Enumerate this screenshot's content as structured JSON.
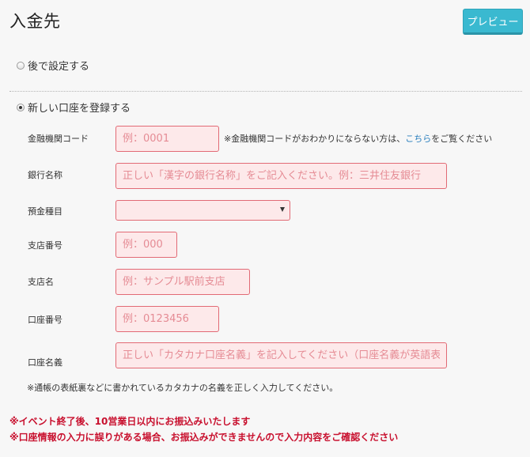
{
  "header": {
    "title": "入金先",
    "preview_label": "プレビュー"
  },
  "options": {
    "later": {
      "label": "後で設定する",
      "selected": false
    },
    "new_account": {
      "label": "新しい口座を登録する",
      "selected": true
    }
  },
  "form": {
    "bank_code": {
      "label": "金融機関コード",
      "value": "",
      "placeholder": "例：0001"
    },
    "bank_code_note": {
      "prefix": "※金融機関コードがおわかりにならない方は、",
      "link": "こちら",
      "suffix": "をご覧ください"
    },
    "bank_name": {
      "label": "銀行名称",
      "value": "",
      "placeholder": "正しい「漢字の銀行名称」をご記入ください。例：三井住友銀行"
    },
    "deposit_type": {
      "label": "預金種目",
      "selected": ""
    },
    "branch_number": {
      "label": "支店番号",
      "value": "",
      "placeholder": "例：000"
    },
    "branch_name": {
      "label": "支店名",
      "value": "",
      "placeholder": "例：サンプル駅前支店"
    },
    "account_number": {
      "label": "口座番号",
      "value": "",
      "placeholder": "例：0123456"
    },
    "account_holder": {
      "label": "口座名義",
      "value": "",
      "placeholder": "正しい「カタカナ口座名義」を記入してください（口座名義が英語表記の場合は英語で記入）"
    },
    "account_holder_note": "※通帳の表紙裏などに書かれているカタカナの名義を正しく入力してください。"
  },
  "warnings": [
    "※イベント終了後、10営業日以内にお振込みいたします",
    "※口座情報の入力に誤りがある場合、お振込みができませんので入力内容をご確認ください"
  ],
  "colors": {
    "accent": "#3ab9d0",
    "input_bg": "#fde9ea",
    "input_border": "#e26a75",
    "warning": "#c8102e",
    "link": "#2a7fbd"
  }
}
